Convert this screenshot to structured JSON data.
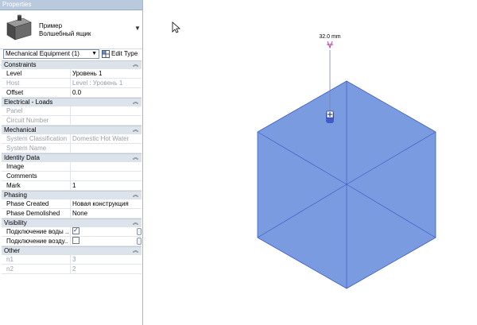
{
  "panel": {
    "title": "Properties"
  },
  "type_selector": {
    "family": "Пример",
    "type": "Волшебный ящик"
  },
  "category_dropdown": {
    "value": "Mechanical Equipment (1)"
  },
  "edit_type": {
    "label": "Edit Type"
  },
  "groups": [
    {
      "title": "Constraints",
      "rows": [
        {
          "k": "Level",
          "v": "Уровень 1"
        },
        {
          "k": "Host",
          "v": "Level : Уровень 1",
          "dim": true
        },
        {
          "k": "Offset",
          "v": "0.0"
        }
      ]
    },
    {
      "title": "Electrical - Loads",
      "rows": [
        {
          "k": "Panel",
          "v": "",
          "dim": true
        },
        {
          "k": "Circuit Number",
          "v": "",
          "dim": true
        }
      ]
    },
    {
      "title": "Mechanical",
      "rows": [
        {
          "k": "System Classification",
          "v": "Domestic Hot Water",
          "dim": true
        },
        {
          "k": "System Name",
          "v": "",
          "dim": true
        }
      ]
    },
    {
      "title": "Identity Data",
      "rows": [
        {
          "k": "Image",
          "v": ""
        },
        {
          "k": "Comments",
          "v": ""
        },
        {
          "k": "Mark",
          "v": "1"
        }
      ]
    },
    {
      "title": "Phasing",
      "rows": [
        {
          "k": "Phase Created",
          "v": "Новая конструкция"
        },
        {
          "k": "Phase Demolished",
          "v": "None"
        }
      ]
    },
    {
      "title": "Visibility",
      "rows": [
        {
          "k": "Подключение воды ...",
          "checkbox": true,
          "checked": true
        },
        {
          "k": "Подключение возду...",
          "checkbox": true,
          "checked": false
        }
      ]
    },
    {
      "title": "Other",
      "rows": [
        {
          "k": "n1",
          "v": "3",
          "dim": true
        },
        {
          "k": "n2",
          "v": "2",
          "dim": true
        }
      ]
    }
  ],
  "canvas": {
    "dimension_label": "32.0 mm",
    "cube_color": "#7b9be0",
    "edge_color": "#3f5cc7"
  }
}
